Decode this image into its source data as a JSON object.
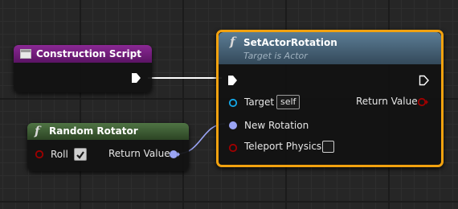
{
  "nodes": {
    "construction_script": {
      "title": "Construction Script",
      "header_color": "#7a1e83"
    },
    "random_rotator": {
      "title": "Random Rotator",
      "function_glyph": "f",
      "header_color": "#3c5a32",
      "roll_label": "Roll",
      "roll_checked": true,
      "return_label": "Return Value"
    },
    "set_actor_rotation": {
      "title": "SetActorRotation",
      "subtitle": "Target is Actor",
      "function_glyph": "f",
      "header_color": "#4a6a82",
      "target_label": "Target",
      "target_value": "self",
      "new_rotation_label": "New Rotation",
      "teleport_label": "Teleport Physics",
      "teleport_checked": false,
      "return_label": "Return Value"
    }
  },
  "colors": {
    "exec_wire": "#ffffff",
    "rotator_wire": "#9aa4f5",
    "bool_pin": "#a00000",
    "object_pin": "#14a8e8",
    "selection": "#f2a20f"
  },
  "icons": {
    "event_icon": "construction-script-icon",
    "exec": "exec-arrow-icon",
    "checkbox": "checkbox-icon"
  }
}
